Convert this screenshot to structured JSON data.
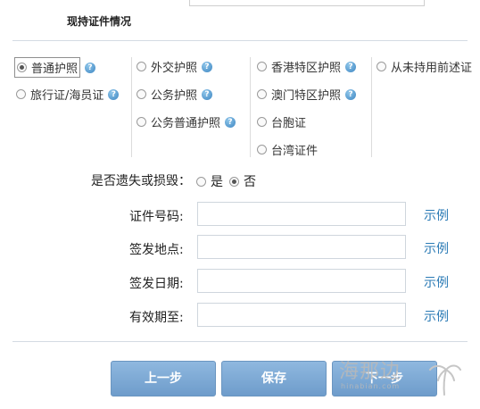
{
  "section_title": "现持证件情况",
  "id_types": [
    {
      "label": "普通护照",
      "selected": true,
      "help": true
    },
    {
      "label": "旅行证/海员证",
      "selected": false,
      "help": true
    },
    {
      "label": "外交护照",
      "selected": false,
      "help": true
    },
    {
      "label": "公务护照",
      "selected": false,
      "help": true
    },
    {
      "label": "公务普通护照",
      "selected": false,
      "help": true
    },
    {
      "label": "香港特区护照",
      "selected": false,
      "help": true
    },
    {
      "label": "澳门特区护照",
      "selected": false,
      "help": true
    },
    {
      "label": "台胞证",
      "selected": false,
      "help": false
    },
    {
      "label": "台湾证件",
      "selected": false,
      "help": false
    },
    {
      "label": "从未持用前述证",
      "selected": false,
      "help": false
    }
  ],
  "help_glyph": "?",
  "lost_question": {
    "label": "是否遗失或损毁：",
    "options": [
      {
        "label": "是",
        "selected": false
      },
      {
        "label": "否",
        "selected": true
      }
    ]
  },
  "fields": [
    {
      "label": "证件号码:",
      "value": "",
      "example": "示例"
    },
    {
      "label": "签发地点:",
      "value": "",
      "example": "示例"
    },
    {
      "label": "签发日期:",
      "value": "",
      "example": "示例"
    },
    {
      "label": "有效期至:",
      "value": "",
      "example": "示例"
    }
  ],
  "buttons": {
    "prev": "上一步",
    "save": "保存",
    "next": "下一步"
  },
  "watermark": {
    "text": "海那边",
    "url": "hinabian.com"
  }
}
